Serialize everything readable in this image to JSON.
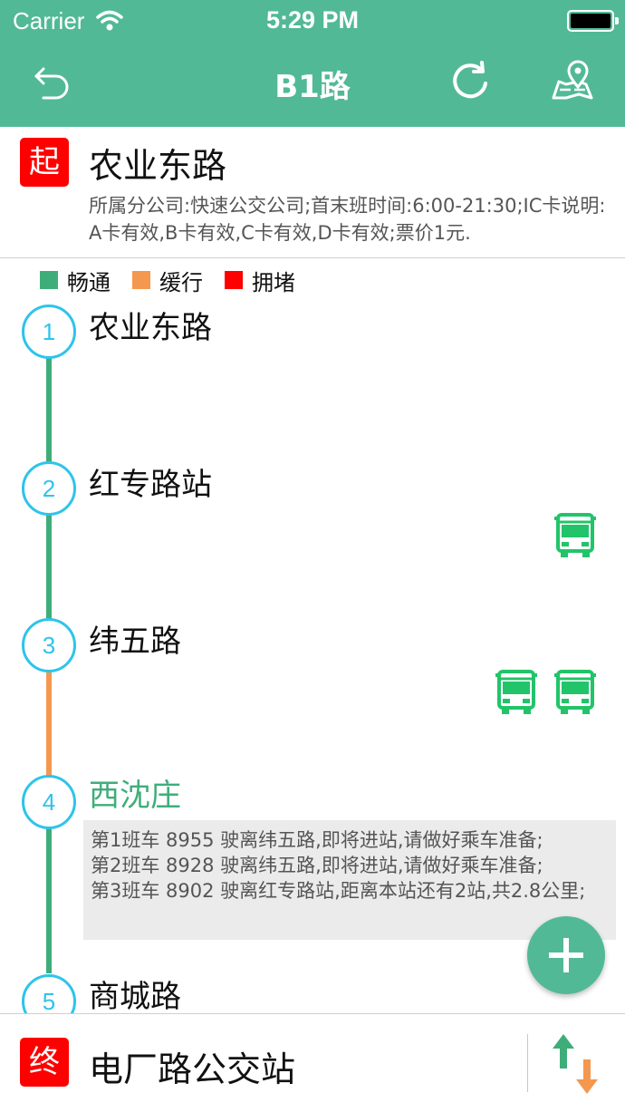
{
  "status_bar": {
    "carrier": "Carrier",
    "time": "5:29 PM"
  },
  "nav": {
    "title": "B1路"
  },
  "start": {
    "badge": "起",
    "name": "农业东路",
    "info": "所属分公司:快速公交公司;首末班时间:6:00-21:30;IC卡说明:A卡有效,B卡有效,C卡有效,D卡有效;票价1元."
  },
  "legend": [
    {
      "label": "畅通",
      "color": "#3fad7a"
    },
    {
      "label": "缓行",
      "color": "#f4984f"
    },
    {
      "label": "拥堵",
      "color": "#ff0000"
    }
  ],
  "stations": [
    {
      "number": "1",
      "name": "农业东路"
    },
    {
      "number": "2",
      "name": "红专路站"
    },
    {
      "number": "3",
      "name": "纬五路"
    },
    {
      "number": "4",
      "name": "西沈庄"
    },
    {
      "number": "5",
      "name": "商城路"
    }
  ],
  "segments": [
    {
      "status": "畅通",
      "color": "#3fad7a"
    },
    {
      "status": "畅通",
      "color": "#3fad7a"
    },
    {
      "status": "缓行",
      "color": "#f4984f"
    },
    {
      "status": "畅通",
      "color": "#3fad7a"
    }
  ],
  "arrival_info": [
    "第1班车 8955 驶离纬五路,即将进站,请做好乘车准备;",
    "第2班车 8928 驶离纬五路,即将进站,请做好乘车准备;",
    "第3班车 8902 驶离红专路站,距离本站还有2站,共2.8公里;"
  ],
  "end": {
    "badge": "终",
    "name": "电厂路公交站"
  },
  "colors": {
    "primary": "#52b996",
    "accent": "#2ec4ea",
    "bus": "#22c46a"
  }
}
